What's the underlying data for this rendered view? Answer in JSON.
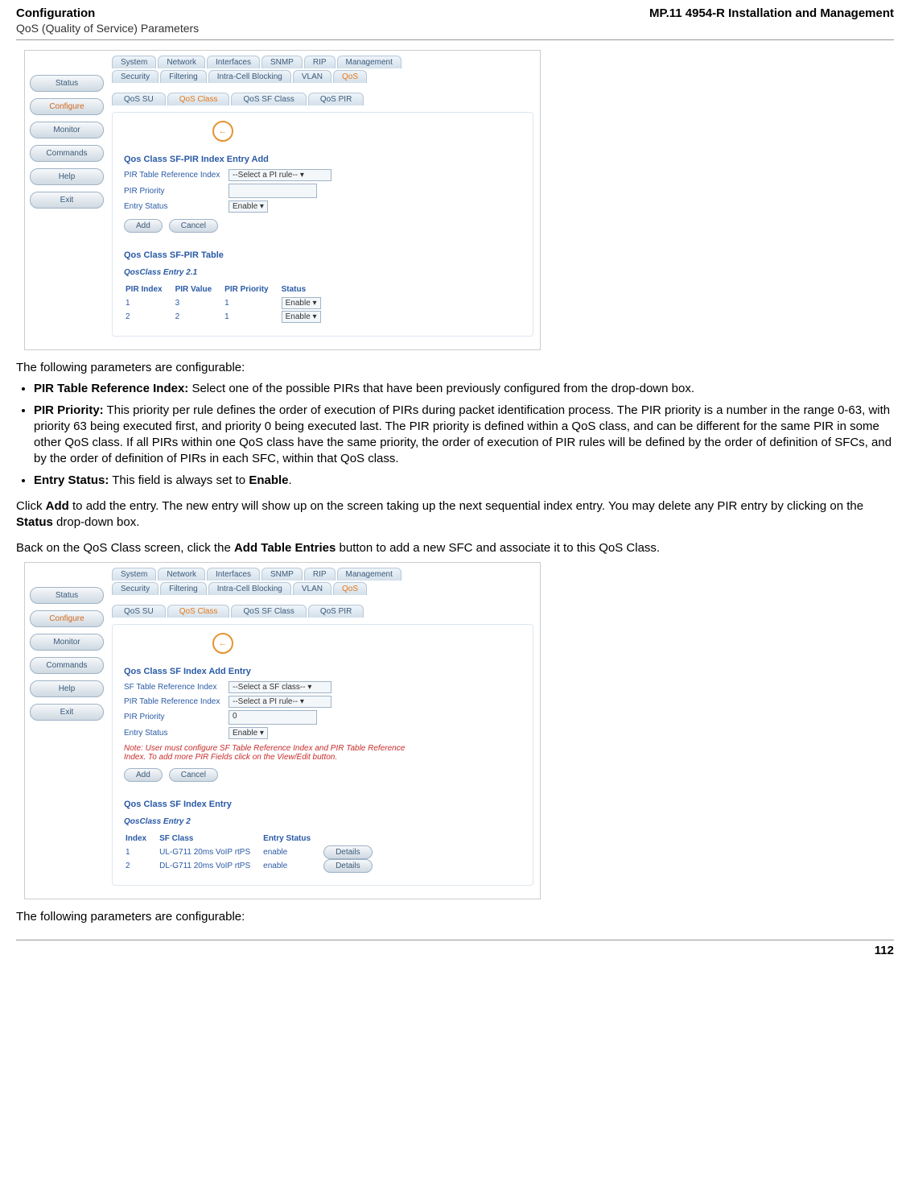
{
  "header": {
    "left_title": "Configuration",
    "left_sub": "QoS (Quality of Service) Parameters",
    "right": "MP.11 4954-R Installation and Management"
  },
  "sidebar": [
    "Status",
    "Configure",
    "Monitor",
    "Commands",
    "Help",
    "Exit"
  ],
  "top_tabs": [
    "System",
    "Network",
    "Interfaces",
    "SNMP",
    "RIP",
    "Management"
  ],
  "mid_tabs": [
    "Security",
    "Filtering",
    "Intra-Cell Blocking",
    "VLAN",
    "QoS"
  ],
  "sub_tabs": [
    "QoS SU",
    "QoS Class",
    "QoS SF Class",
    "QoS PIR"
  ],
  "screenshot1": {
    "section1_title": "Qos Class SF-PIR Index Entry Add",
    "field_pir_ref": "PIR Table Reference Index",
    "field_pir_ref_val": "--Select a PI rule--",
    "field_pir_priority": "PIR Priority",
    "field_entry_status": "Entry Status",
    "field_entry_status_val": "Enable",
    "btn_add": "Add",
    "btn_cancel": "Cancel",
    "section2_title": "Qos Class SF-PIR Table",
    "entry_sub": "QosClass Entry 2.1",
    "table_headers": [
      "PIR Index",
      "PIR Value",
      "PIR Priority",
      "Status"
    ],
    "table_rows": [
      {
        "idx": "1",
        "val": "3",
        "pri": "1",
        "status": "Enable"
      },
      {
        "idx": "2",
        "val": "2",
        "pri": "1",
        "status": "Enable"
      }
    ]
  },
  "body": {
    "p1": "The following parameters are configurable:",
    "b1_label": "PIR Table Reference Index:",
    "b1_text": " Select one of the possible PIRs that have been previously configured from the drop-down box.",
    "b2_label": "PIR Priority:",
    "b2_text": " This priority per rule defines the order of execution of PIRs during packet identification process. The PIR priority is a number in the range 0-63, with priority 63 being executed first, and priority 0 being executed last. The PIR priority is defined within a QoS class, and can be different for the same PIR in some other QoS class. If all PIRs within one QoS class have the same priority, the order of execution of PIR rules will be defined by the order of definition of SFCs, and by the order of definition of PIRs in each SFC, within that QoS class.",
    "b3_label": "Entry Status:",
    "b3_text_a": " This field is always set to ",
    "b3_text_b": "Enable",
    "b3_text_c": ".",
    "p2a": "Click ",
    "p2b": "Add",
    "p2c": " to add the entry. The new entry will show up on the screen taking up the next sequential index entry. You may delete any PIR entry by clicking on the ",
    "p2d": "Status",
    "p2e": " drop-down box.",
    "p3a": "Back on the QoS Class screen, click the ",
    "p3b": "Add Table Entries",
    "p3c": " button to add a new SFC and associate it to this QoS Class.",
    "p4": "The following parameters are configurable:"
  },
  "screenshot2": {
    "section1_title": "Qos Class SF Index Add Entry",
    "field_sf_ref": "SF Table Reference Index",
    "field_sf_ref_val": "--Select a SF class--",
    "field_pir_ref": "PIR Table Reference Index",
    "field_pir_ref_val": "--Select a PI rule--",
    "field_pir_priority": "PIR Priority",
    "field_pir_priority_val": "0",
    "field_entry_status": "Entry Status",
    "field_entry_status_val": "Enable",
    "note": "Note: User must configure SF Table Reference Index and PIR Table Reference Index. To add more PIR Fields click on the View/Edit button.",
    "btn_add": "Add",
    "btn_cancel": "Cancel",
    "section2_title": "Qos Class SF Index Entry",
    "entry_sub": "QosClass Entry 2",
    "table_headers": [
      "Index",
      "SF Class",
      "Entry Status",
      ""
    ],
    "table_rows": [
      {
        "idx": "1",
        "sfc": "UL-G711 20ms VoIP rtPS",
        "status": "enable",
        "btn": "Details"
      },
      {
        "idx": "2",
        "sfc": "DL-G711 20ms VoIP rtPS",
        "status": "enable",
        "btn": "Details"
      }
    ]
  },
  "footer": {
    "page": "112"
  }
}
